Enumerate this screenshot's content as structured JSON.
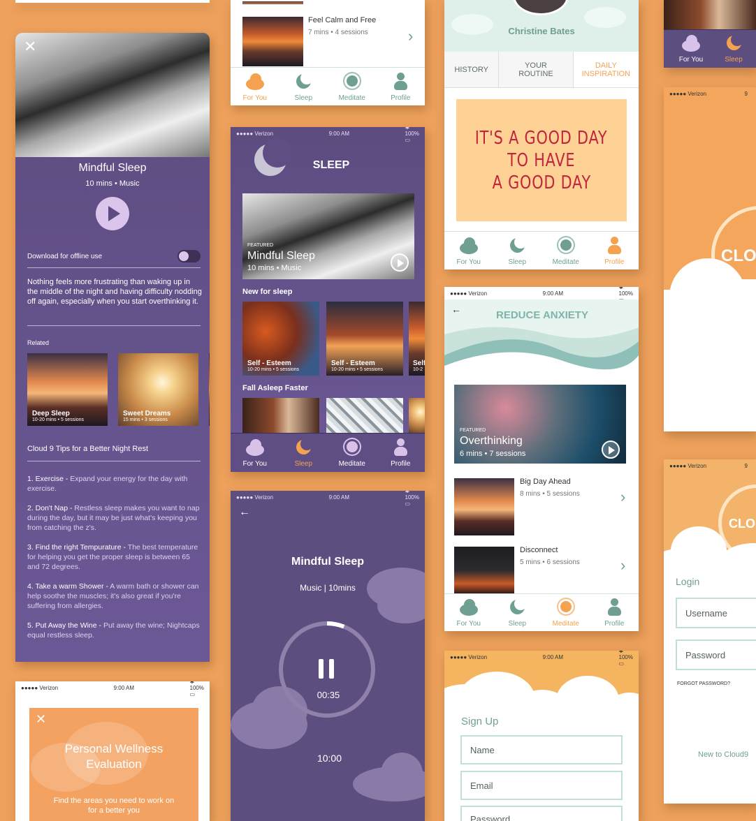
{
  "colors": {
    "background": "#eda15c",
    "purple": "#63528a",
    "teal": "#6f9f93",
    "orange": "#f4a250",
    "lilac": "#d9c2ea"
  },
  "mindful": {
    "title": "Mindful Sleep",
    "meta": "10 mins • Music",
    "download_label": "Download for offline use",
    "description": "Nothing feels more frustrating than waking up in the middle of the night and having difficulty nodding off again, especially when you start overthinking it.",
    "related_label": "Related",
    "related": [
      {
        "title": "Deep Sleep",
        "meta": "10-20 mins • 5 sessions"
      },
      {
        "title": "Sweet Dreams",
        "meta": "15 mins • 3 sessions"
      }
    ],
    "tips_title": "Cloud 9 Tips for a Better Night Rest",
    "tips": [
      {
        "head": "1. Exercise - ",
        "body": "Expand your energy for the day with exercise."
      },
      {
        "head": "2. Don't Nap - ",
        "body": "Restless sleep makes you want to nap during the day, but it may be just  what's keeping you from catching the z's."
      },
      {
        "head": "3. Find the right Tempurature - ",
        "body": "The best temperature for helping you get the proper sleep is between 65 and 72 degrees."
      },
      {
        "head": "4. Take a warm Shower - ",
        "body": "A warm bath or shower can help soothe the muscles; it's also great if you're suffering from allergies."
      },
      {
        "head": "5. Put Away the Wine - ",
        "body": "Put away the wine; Nightcaps equal restless sleep."
      }
    ]
  },
  "status": {
    "carrier": "●●●●● Verizon",
    "time": "9:00 AM",
    "battery": "100%"
  },
  "nav": {
    "for_you": "For You",
    "sleep": "Sleep",
    "meditate": "Meditate",
    "profile": "Profile"
  },
  "feel_calm": {
    "title": "Feel Calm and Free",
    "meta": "7 mins • 4 sessions"
  },
  "sleep_screen": {
    "title": "SLEEP",
    "featured_tag": "FEATURED",
    "featured_title": "Mindful Sleep",
    "featured_meta": "10 mins • Music",
    "new_label": "New for sleep",
    "tiles": [
      {
        "title": "Self - Esteem",
        "meta": "10-20 mins • 5 sessions"
      },
      {
        "title": "Self - Esteem",
        "meta": "10-20 mins • 5 sessions"
      },
      {
        "title": "Self",
        "meta": "10-2"
      }
    ],
    "fall_label": "Fall Asleep Faster"
  },
  "player": {
    "title": "Mindful Sleep",
    "meta": "Music  |  10mins",
    "elapsed": "00:35",
    "duration": "10:00",
    "progress": 0.06
  },
  "profile": {
    "name": "Christine Bates",
    "tabs": [
      "HISTORY",
      "YOUR ROUTINE",
      "DAILY INSPIRATION"
    ],
    "quote_lines": [
      "IT'S A GOOD DAY",
      "TO HAVE",
      "A GOOD DAY"
    ]
  },
  "anxiety": {
    "title": "REDUCE ANXIETY",
    "featured_tag": "FEATURED",
    "featured_title": "Overthinking",
    "featured_meta": "6 mins • 7 sessions",
    "items": [
      {
        "title": "Big Day Ahead",
        "meta": "8  mins • 5 sessions"
      },
      {
        "title": "Disconnect",
        "meta": "5  mins • 6 sessions"
      }
    ]
  },
  "signup": {
    "title": "Sign Up",
    "name": "Name",
    "email": "Email",
    "password": "Password"
  },
  "login": {
    "brand": "CLO",
    "title": "Login",
    "username": "Username",
    "password": "Password",
    "forgot": "FORGOT PASSWORD?",
    "new_link": "New to Cloud9"
  },
  "evaluation": {
    "title": "Personal Wellness Evaluation",
    "subtitle": "Find the areas you need to work on for a better you"
  }
}
